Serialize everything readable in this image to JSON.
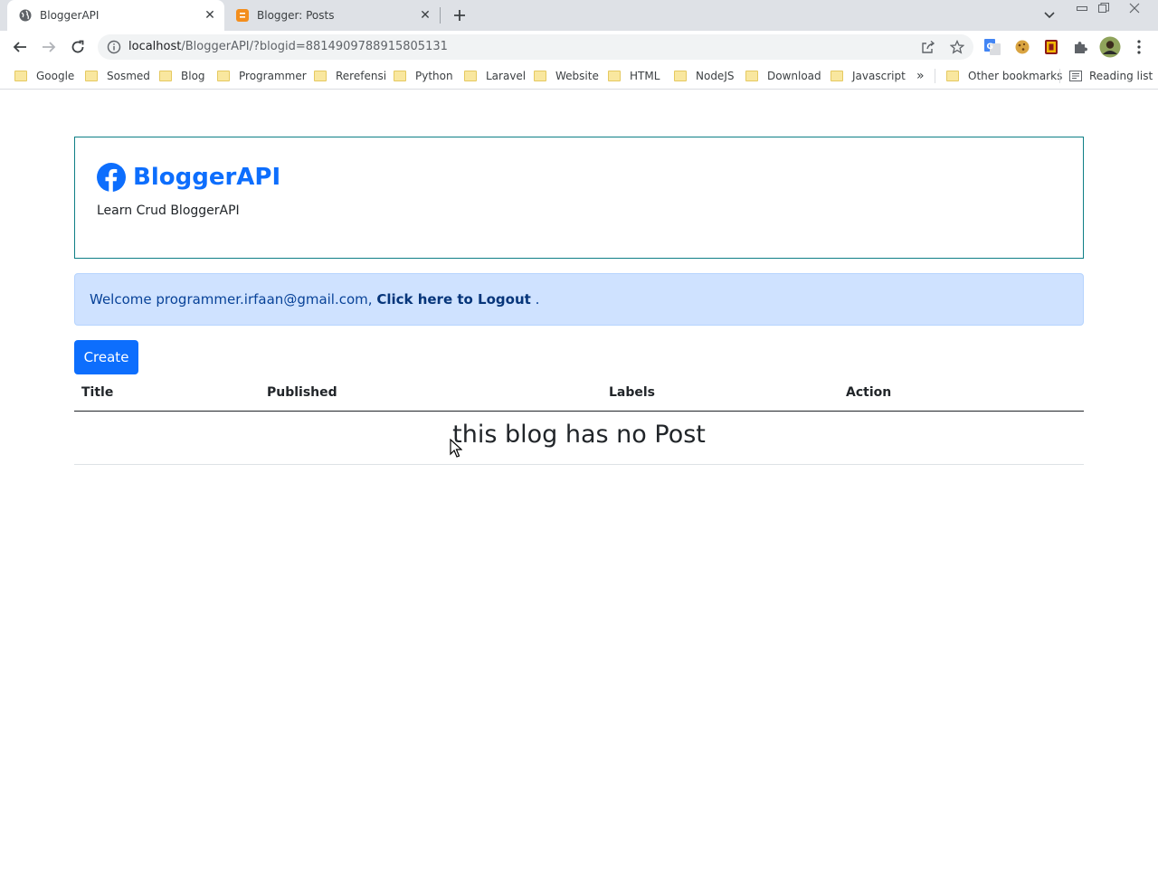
{
  "browser": {
    "tabs": [
      {
        "title": "BloggerAPI",
        "active": true,
        "icon": "globe-icon"
      },
      {
        "title": "Blogger: Posts",
        "active": false,
        "icon": "blogger-icon"
      }
    ],
    "url": {
      "host": "localhost",
      "path": "/BloggerAPI/?blogid=8814909788915805131"
    },
    "bookmarks": [
      "Google",
      "Sosmed",
      "Blog",
      "Programmer",
      "Rerefensi",
      "Python",
      "Laravel",
      "Website",
      "HTML",
      "NodeJS",
      "Download",
      "Javascript"
    ],
    "bookmarks_overflow": "»",
    "other_bookmarks": "Other bookmarks",
    "reading_list": "Reading list"
  },
  "header": {
    "brand": "BloggerAPI",
    "tagline": "Learn Crud BloggerAPI"
  },
  "alert": {
    "prefix": "Welcome programmer.irfaan@gmail.com, ",
    "logout_link": "Click here to Logout",
    "suffix": " ."
  },
  "actions": {
    "create_label": "Create"
  },
  "table": {
    "columns": [
      "Title",
      "Published",
      "Labels",
      "Action"
    ],
    "empty_message": "this blog has no Post"
  },
  "colors": {
    "primary": "#0d6efd",
    "alert_bg": "#cfe2ff",
    "card_border": "#0d7f86"
  }
}
